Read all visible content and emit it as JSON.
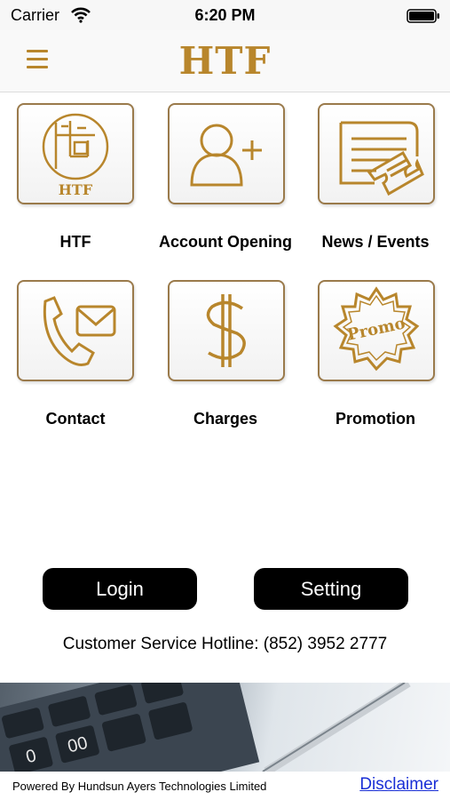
{
  "status_bar": {
    "carrier": "Carrier",
    "time": "6:20 PM"
  },
  "header": {
    "logo_text": "HTF"
  },
  "tiles": [
    {
      "label": "HTF",
      "icon": "htf-emblem-icon",
      "badge_text": "HTF"
    },
    {
      "label": "Account Opening",
      "icon": "add-user-icon"
    },
    {
      "label": "News / Events",
      "icon": "news-ticket-icon"
    },
    {
      "label": "Contact",
      "icon": "phone-mail-icon"
    },
    {
      "label": "Charges",
      "icon": "dollar-icon"
    },
    {
      "label": "Promotion",
      "icon": "promo-badge-icon",
      "badge_text": "Promo"
    }
  ],
  "buttons": {
    "login": "Login",
    "setting": "Setting"
  },
  "hotline": "Customer Service Hotline: (852) 3952 2777",
  "footer": {
    "powered_by": "Powered By Hundsun Ayers Technologies Limited",
    "disclaimer": "Disclaimer",
    "banner_keys": [
      "0",
      "00"
    ]
  },
  "colors": {
    "accent": "#b8862c",
    "tile_border": "#9a7a4b",
    "link": "#1a2fd6",
    "button": "#000000"
  }
}
